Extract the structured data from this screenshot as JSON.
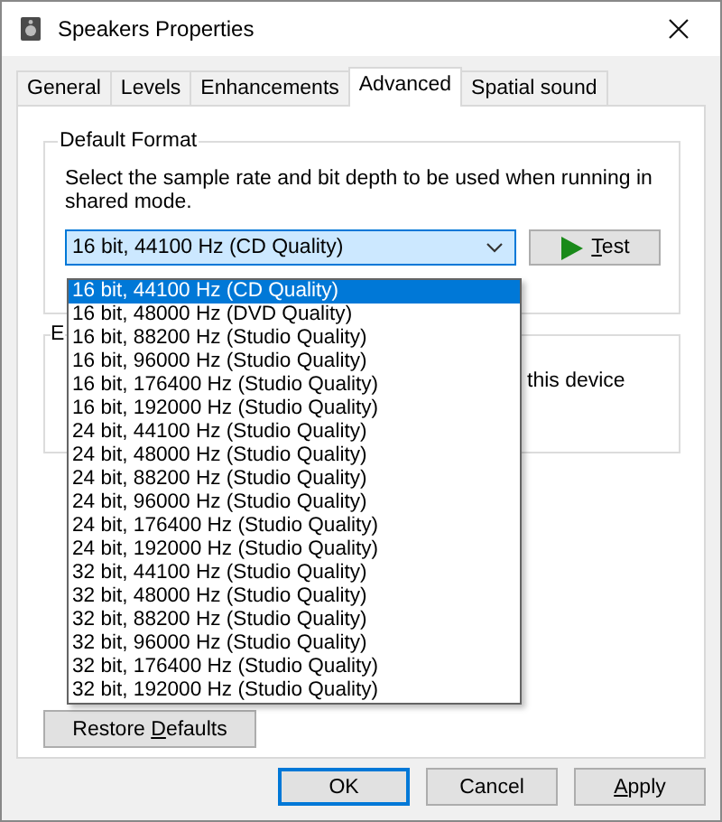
{
  "window": {
    "title": "Speakers Properties"
  },
  "tabs": [
    {
      "label": "General",
      "selected": false
    },
    {
      "label": "Levels",
      "selected": false
    },
    {
      "label": "Enhancements",
      "selected": false
    },
    {
      "label": "Advanced",
      "selected": true
    },
    {
      "label": "Spatial sound",
      "selected": false
    }
  ],
  "default_format": {
    "title": "Default Format",
    "description": "Select the sample rate and bit depth to be used when running in shared mode.",
    "format_dropdown": {
      "value": "16 bit, 44100 Hz (CD Quality)",
      "expanded": true,
      "options": [
        {
          "label": "16 bit, 44100 Hz (CD Quality)",
          "selected": true
        },
        {
          "label": "16 bit, 48000 Hz (DVD Quality)",
          "selected": false
        },
        {
          "label": "16 bit, 88200 Hz (Studio Quality)",
          "selected": false
        },
        {
          "label": "16 bit, 96000 Hz (Studio Quality)",
          "selected": false
        },
        {
          "label": "16 bit, 176400 Hz (Studio Quality)",
          "selected": false
        },
        {
          "label": "16 bit, 192000 Hz (Studio Quality)",
          "selected": false
        },
        {
          "label": "24 bit, 44100 Hz (Studio Quality)",
          "selected": false
        },
        {
          "label": "24 bit, 48000 Hz (Studio Quality)",
          "selected": false
        },
        {
          "label": "24 bit, 88200 Hz (Studio Quality)",
          "selected": false
        },
        {
          "label": "24 bit, 96000 Hz (Studio Quality)",
          "selected": false
        },
        {
          "label": "24 bit, 176400 Hz (Studio Quality)",
          "selected": false
        },
        {
          "label": "24 bit, 192000 Hz (Studio Quality)",
          "selected": false
        },
        {
          "label": "32 bit, 44100 Hz (Studio Quality)",
          "selected": false
        },
        {
          "label": "32 bit, 48000 Hz (Studio Quality)",
          "selected": false
        },
        {
          "label": "32 bit, 88200 Hz (Studio Quality)",
          "selected": false
        },
        {
          "label": "32 bit, 96000 Hz (Studio Quality)",
          "selected": false
        },
        {
          "label": "32 bit, 176400 Hz (Studio Quality)",
          "selected": false
        },
        {
          "label": "32 bit, 192000 Hz (Studio Quality)",
          "selected": false
        }
      ]
    },
    "test_button": {
      "access_key": "T",
      "label_rest": "est"
    }
  },
  "exclusive_mode": {
    "title": "E",
    "text": "this device"
  },
  "restore_button": {
    "label_before": "Restore ",
    "access_key": "D",
    "label_after": "efaults"
  },
  "buttons": [
    {
      "label_after": "OK",
      "default": true
    },
    {
      "label_after": "Cancel",
      "default": false
    },
    {
      "access_key": "A",
      "label_after": "pply",
      "default": false
    }
  ]
}
